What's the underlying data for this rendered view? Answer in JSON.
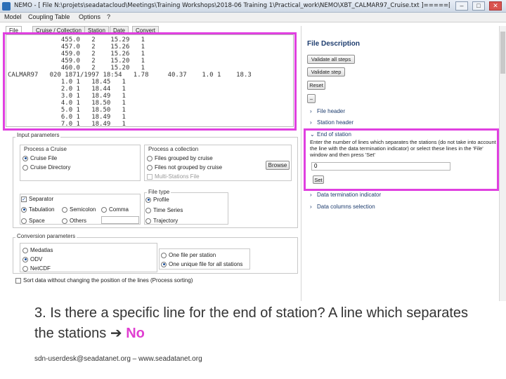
{
  "window": {
    "title": "NEMO - [ File N:\\projets\\seadatacloud\\Meetings\\Training Workshops\\2018-06 Training 1\\Practical_work\\NEMO\\XBT_CALMAR97_Cruise.txt ]=====[ Model model_c...",
    "minimize": "–",
    "maximize": "□",
    "close": "✕"
  },
  "menu": [
    "Model",
    "Coupling Table",
    "Options",
    "?"
  ],
  "tabs": [
    "File",
    "Cruise / Collection",
    "Station",
    "Date",
    "Convert"
  ],
  "file_lines": [
    "              455.0   2    15.29   1",
    "              457.0   2    15.26   1",
    "              459.0   2    15.26   1",
    "              459.0   2    15.20   1",
    "              460.0   2    15.20   1",
    "CALMAR97   020 1871/1997 18:54   1.78     40.37    1.0 1    18.3",
    "              1.0 1   18.45   1",
    "              2.0 1   18.44   1",
    "              3.0 1   18.49   1",
    "              4.0 1   18.50   1",
    "              5.0 1   18.50   1",
    "              6.0 1   18.49   1",
    "              7.0 1   18.49   1"
  ],
  "input_params": {
    "label": "Input parameters",
    "process_cruise": {
      "label": "Process a Cruise",
      "options": [
        "Cruise File",
        "Cruise Directory"
      ]
    },
    "process_collection": {
      "label": "Process a collection",
      "options": [
        "Files grouped by cruise",
        "Files not grouped by cruise"
      ],
      "multi_stations": "Multi-Stations File"
    },
    "browse": "Browse",
    "separator": {
      "label": "Separator",
      "options": [
        "Tabulation",
        "Semicolon",
        "Comma",
        "Space",
        "Others"
      ]
    },
    "file_type": {
      "label": "File type",
      "options": [
        "Profile",
        "Time Series",
        "Trajectory"
      ]
    }
  },
  "conversion_params": {
    "label": "Conversion parameters",
    "formats": [
      "Medatlas",
      "ODV",
      "NetCDF"
    ],
    "output": [
      "One file per station",
      "One unique file for all stations"
    ],
    "sort_option": "Sort data without changing the position of the lines (Process sorting)"
  },
  "right_panel": {
    "title": "File Description",
    "buttons": [
      "Validate all steps",
      "Validate step",
      "Reset",
      "–"
    ],
    "sections": [
      "File header",
      "Station header",
      "End of station",
      "Data termination indicator",
      "Data columns selection"
    ],
    "end_of_station_help": "Enter the number of lines which separates the stations (do not take into account the line with the data termination indicator) or select these lines in the 'File' window and then press 'Set'",
    "end_of_station_value": "0",
    "set_button": "Set"
  },
  "slide": {
    "question": "3.  Is there a specific line for the end of station? A line which separates the stations",
    "arrow": "➔",
    "answer": "No",
    "footer": "sdn-userdesk@seadatanet.org – www.seadatanet.org"
  },
  "colors": {
    "highlight": "#e040e0",
    "answer": "#e03fd1",
    "link": "#1d3c6e"
  }
}
